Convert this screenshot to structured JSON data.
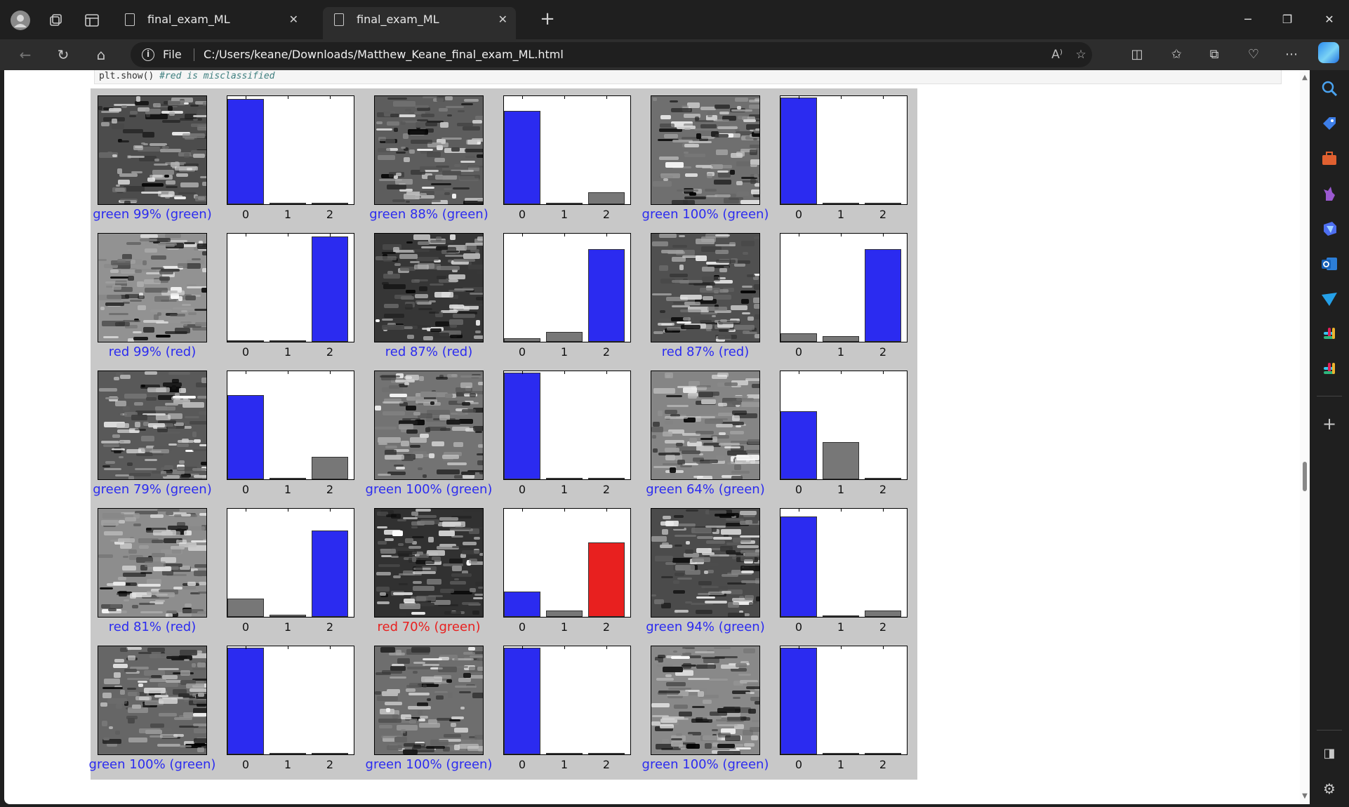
{
  "tabs": [
    {
      "title": "final_exam_ML",
      "active": false
    },
    {
      "title": "final_exam_ML",
      "active": true
    }
  ],
  "address": {
    "scheme": "File",
    "url": "C:/Users/keane/Downloads/Matthew_Keane_final_exam_ML.html"
  },
  "code": {
    "prefix": "plt.show()",
    "comment": "#red is misclassified"
  },
  "colors": {
    "correct": "#2b2bf0",
    "wrong": "#e8201f",
    "other_bar": "#777777"
  },
  "chart_data": {
    "type": "bar",
    "title": "",
    "categories": [
      "0",
      "1",
      "2"
    ],
    "grid": false,
    "panels": [
      {
        "caption": "green 99% (green)",
        "correct": true,
        "pred": 0,
        "values": [
          0.99,
          0.0,
          0.01
        ]
      },
      {
        "caption": "green 88% (green)",
        "correct": true,
        "pred": 0,
        "values": [
          0.88,
          0.01,
          0.11
        ]
      },
      {
        "caption": "green 100% (green)",
        "correct": true,
        "pred": 0,
        "values": [
          1.0,
          0.0,
          0.0
        ]
      },
      {
        "caption": "red 99% (red)",
        "correct": true,
        "pred": 2,
        "values": [
          0.01,
          0.0,
          0.99
        ]
      },
      {
        "caption": "red 87% (red)",
        "correct": true,
        "pred": 2,
        "values": [
          0.03,
          0.09,
          0.87
        ]
      },
      {
        "caption": "red 87% (red)",
        "correct": true,
        "pred": 2,
        "values": [
          0.08,
          0.05,
          0.87
        ]
      },
      {
        "caption": "green 79% (green)",
        "correct": true,
        "pred": 0,
        "values": [
          0.79,
          0.0,
          0.21
        ]
      },
      {
        "caption": "green 100% (green)",
        "correct": true,
        "pred": 0,
        "values": [
          1.0,
          0.0,
          0.0
        ]
      },
      {
        "caption": "green 64% (green)",
        "correct": true,
        "pred": 0,
        "values": [
          0.64,
          0.35,
          0.01
        ]
      },
      {
        "caption": "red 81% (red)",
        "correct": true,
        "pred": 2,
        "values": [
          0.17,
          0.02,
          0.81
        ]
      },
      {
        "caption": "red 70% (green)",
        "correct": false,
        "pred": 2,
        "values": [
          0.24,
          0.06,
          0.7
        ]
      },
      {
        "caption": "green 94% (green)",
        "correct": true,
        "pred": 0,
        "values": [
          0.94,
          0.0,
          0.06
        ]
      },
      {
        "caption": "green 100% (green)",
        "correct": true,
        "pred": 0,
        "values": [
          1.0,
          0.0,
          0.0
        ]
      },
      {
        "caption": "green 100% (green)",
        "correct": true,
        "pred": 0,
        "values": [
          1.0,
          0.0,
          0.0
        ]
      },
      {
        "caption": "green 100% (green)",
        "correct": true,
        "pred": 0,
        "values": [
          1.0,
          0.0,
          0.0
        ]
      }
    ]
  }
}
